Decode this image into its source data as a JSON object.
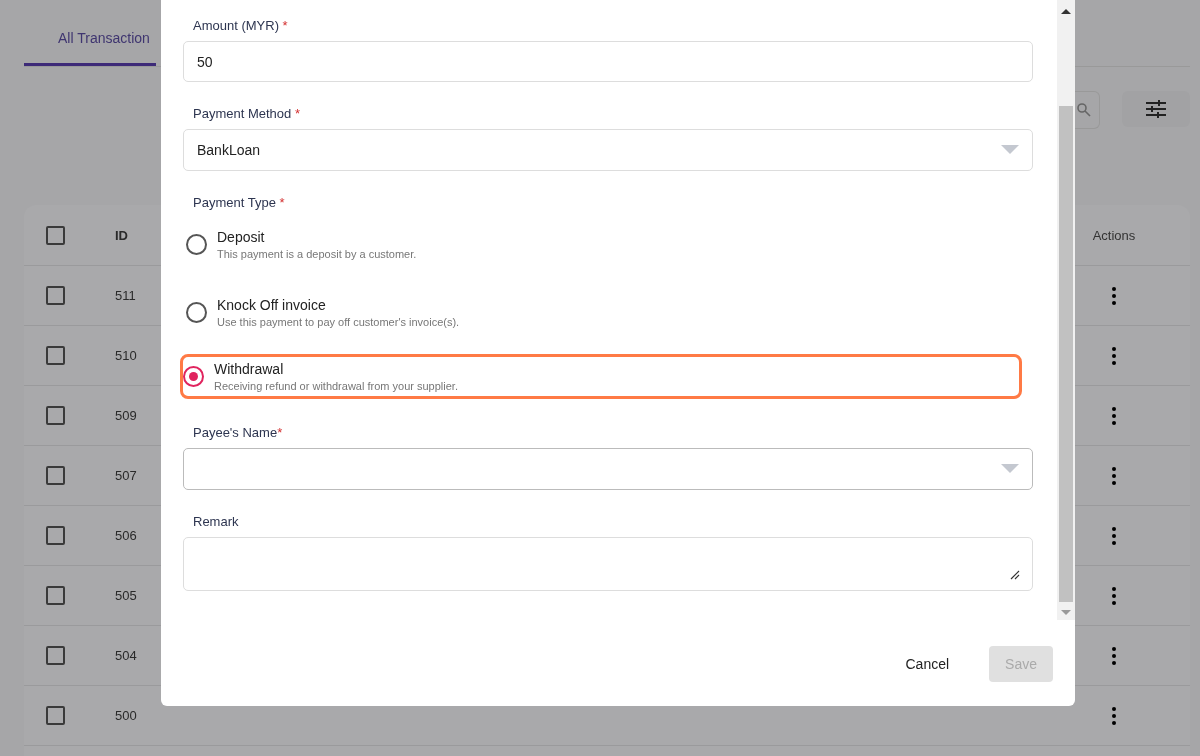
{
  "page": {
    "tabs": [
      {
        "label": "All Transaction",
        "selected": true
      }
    ],
    "table": {
      "header_checked": false,
      "columns": [
        {
          "label": "ID"
        },
        {
          "label": "Actions"
        }
      ],
      "rows": [
        {
          "id": "511",
          "checked": false
        },
        {
          "id": "510",
          "checked": false
        },
        {
          "id": "509",
          "checked": false
        },
        {
          "id": "507",
          "checked": false
        },
        {
          "id": "506",
          "checked": false
        },
        {
          "id": "505",
          "checked": false
        },
        {
          "id": "504",
          "checked": false
        },
        {
          "id": "500",
          "checked": false
        }
      ]
    }
  },
  "dialog": {
    "fields": [
      {
        "kind": "text",
        "label": "Amount (MYR)",
        "required_mark": "*",
        "value": "50"
      },
      {
        "kind": "select",
        "label": "Payment Method",
        "required_mark": "*",
        "value": "BankLoan"
      },
      {
        "kind": "radio",
        "label": "Payment Type",
        "required_mark": "*",
        "options": [
          {
            "label": "Deposit",
            "description": "This payment is a deposit by a customer.",
            "selected": false,
            "highlighted": false
          },
          {
            "label": "Knock Off invoice",
            "description": "Use this payment to pay off customer's invoice(s).",
            "selected": false,
            "highlighted": false
          },
          {
            "label": "Withdrawal",
            "description": "Receiving refund or withdrawal from your supplier.",
            "selected": true,
            "highlighted": true
          }
        ]
      },
      {
        "kind": "select",
        "label": "Payee's Name",
        "required_mark": "*",
        "mark_spaced": false
      },
      {
        "kind": "textarea",
        "label": "Remark"
      }
    ],
    "buttons": [
      {
        "label": "Cancel",
        "disabled": false
      },
      {
        "label": "Save",
        "disabled": true
      }
    ]
  }
}
